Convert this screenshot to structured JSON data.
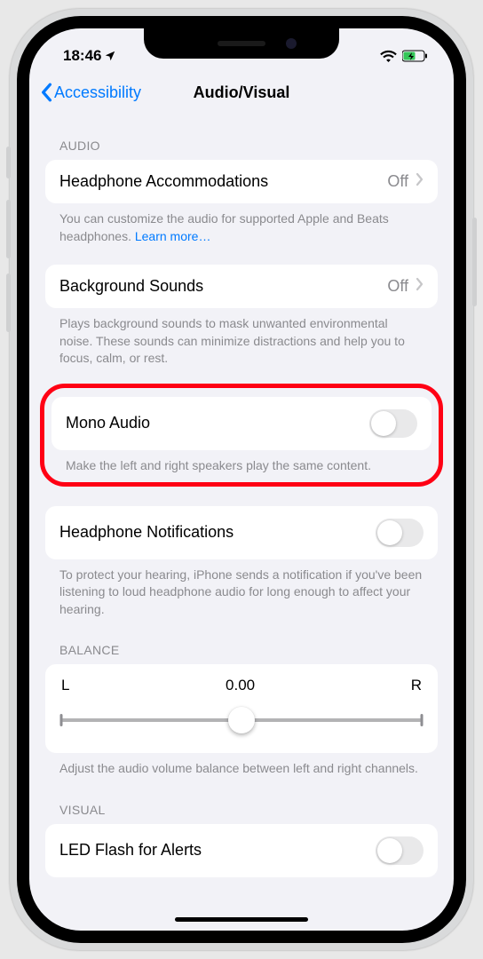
{
  "status": {
    "time": "18:46"
  },
  "nav": {
    "back": "Accessibility",
    "title": "Audio/Visual"
  },
  "sections": {
    "audio_header": "AUDIO",
    "headphone_accom": {
      "label": "Headphone Accommodations",
      "value": "Off"
    },
    "headphone_accom_footer": "You can customize the audio for supported Apple and Beats headphones. ",
    "learn_more": "Learn more…",
    "background_sounds": {
      "label": "Background Sounds",
      "value": "Off"
    },
    "background_sounds_footer": "Plays background sounds to mask unwanted environmental noise. These sounds can minimize distractions and help you to focus, calm, or rest.",
    "mono_audio": {
      "label": "Mono Audio"
    },
    "mono_audio_footer": "Make the left and right speakers play the same content.",
    "headphone_notif": {
      "label": "Headphone Notifications"
    },
    "headphone_notif_footer": "To protect your hearing, iPhone sends a notification if you've been listening to loud headphone audio for long enough to affect your hearing.",
    "balance_header": "BALANCE",
    "balance": {
      "left": "L",
      "value": "0.00",
      "right": "R"
    },
    "balance_footer": "Adjust the audio volume balance between left and right channels.",
    "visual_header": "VISUAL",
    "led_flash": {
      "label": "LED Flash for Alerts"
    }
  }
}
